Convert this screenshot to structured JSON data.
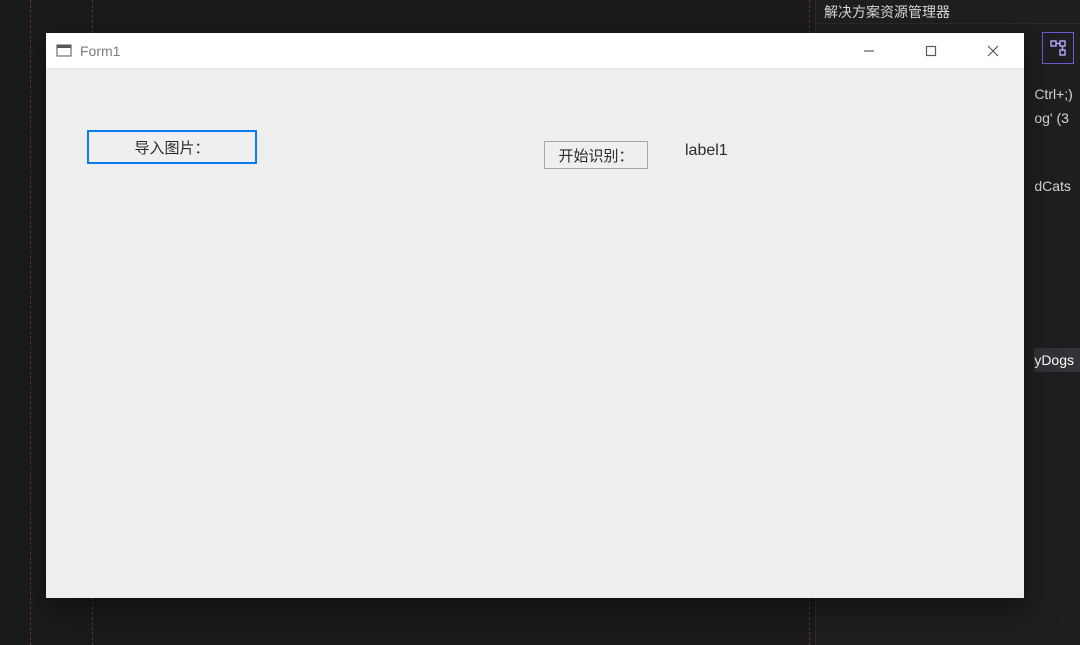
{
  "solution_explorer": {
    "title": "解决方案资源管理器",
    "fragments": {
      "shortcut": "Ctrl+;)",
      "item1": "og' (3",
      "item2": "dCats",
      "item3": "yDogs"
    }
  },
  "form_window": {
    "title": "Form1",
    "buttons": {
      "import_image": "导入图片：",
      "start_recognize": "开始识别："
    },
    "label1": "label1"
  }
}
